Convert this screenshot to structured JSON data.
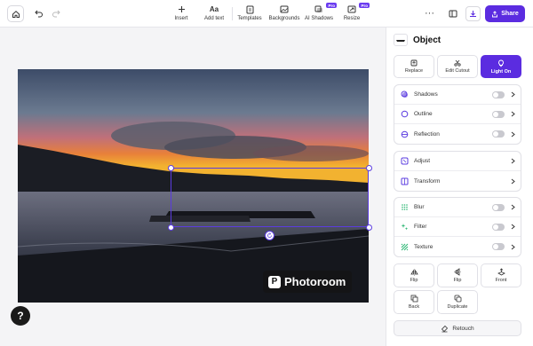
{
  "toolbar": {
    "tools": [
      {
        "label": "Insert",
        "icon": "plus-icon"
      },
      {
        "label": "Add text",
        "icon": "text-icon"
      },
      {
        "label": "Templates",
        "icon": "templates-icon"
      },
      {
        "label": "Backgrounds",
        "icon": "backgrounds-icon"
      },
      {
        "label": "AI Shadows",
        "icon": "ai-shadows-icon",
        "badge": "Pro"
      },
      {
        "label": "Resize",
        "icon": "resize-icon",
        "badge": "Pro"
      }
    ],
    "more_label": "···",
    "share_label": "Share"
  },
  "canvas": {
    "watermark": "Photoroom",
    "help_label": "?"
  },
  "panel": {
    "title": "Object",
    "actions": [
      {
        "label": "Replace",
        "icon": "replace-icon"
      },
      {
        "label": "Edit Cutout",
        "icon": "scissors-icon"
      },
      {
        "label": "Light On",
        "icon": "bulb-icon",
        "active": true
      }
    ],
    "effects": [
      {
        "label": "Shadows",
        "icon": "shadows-icon",
        "toggle": false
      },
      {
        "label": "Outline",
        "icon": "outline-icon",
        "toggle": false
      },
      {
        "label": "Reflection",
        "icon": "reflection-icon",
        "toggle": false
      }
    ],
    "adjust": [
      {
        "label": "Adjust",
        "icon": "adjust-icon"
      },
      {
        "label": "Transform",
        "icon": "transform-icon"
      }
    ],
    "filters": [
      {
        "label": "Blur",
        "icon": "blur-icon",
        "toggle": false
      },
      {
        "label": "Filter",
        "icon": "filter-icon",
        "toggle": false
      },
      {
        "label": "Texture",
        "icon": "texture-icon",
        "toggle": false
      }
    ],
    "arrange": [
      {
        "label": "Flip",
        "icon": "flip-horizontal-icon"
      },
      {
        "label": "Flip",
        "icon": "flip-vertical-icon"
      },
      {
        "label": "Front",
        "icon": "bring-front-icon"
      },
      {
        "label": "Back",
        "icon": "send-back-icon"
      },
      {
        "label": "Duplicate",
        "icon": "duplicate-icon"
      }
    ],
    "retouch_label": "Retouch"
  },
  "colors": {
    "accent": "#5b2ce0",
    "selection": "#5b3ce0",
    "icon_tint": "#5b3ce0"
  }
}
